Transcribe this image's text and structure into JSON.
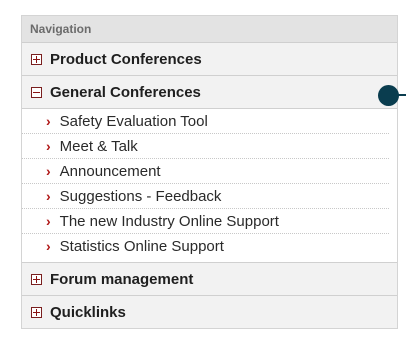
{
  "navigation": {
    "header": "Navigation",
    "sections": [
      {
        "label": "Product Conferences",
        "state": "collapsed"
      },
      {
        "label": "General Conferences",
        "state": "expanded",
        "items": [
          "Safety Evaluation Tool",
          "Meet & Talk",
          "Announcement",
          "Suggestions - Feedback",
          "The new Industry Online Support",
          "Statistics Online Support"
        ]
      },
      {
        "label": "Forum management",
        "state": "collapsed"
      },
      {
        "label": "Quicklinks",
        "state": "collapsed"
      }
    ]
  },
  "colors": {
    "toggle": "#8a1414",
    "chevron": "#b01818",
    "marker": "#0a3d4f"
  },
  "icons": {
    "collapsed": "plus-box-icon",
    "expanded": "minus-box-icon",
    "item": "chevron-right-icon"
  }
}
